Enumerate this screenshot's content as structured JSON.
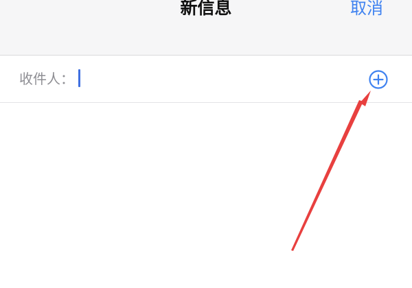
{
  "header": {
    "title": "新信息",
    "cancel_label": "取消"
  },
  "recipient": {
    "label": "收件人：",
    "value": ""
  },
  "icons": {
    "add_contact": "plus-circle-icon"
  },
  "colors": {
    "accent": "#3f82f0",
    "annotation_arrow": "#e8403f",
    "nav_background": "#f6f6f7"
  }
}
